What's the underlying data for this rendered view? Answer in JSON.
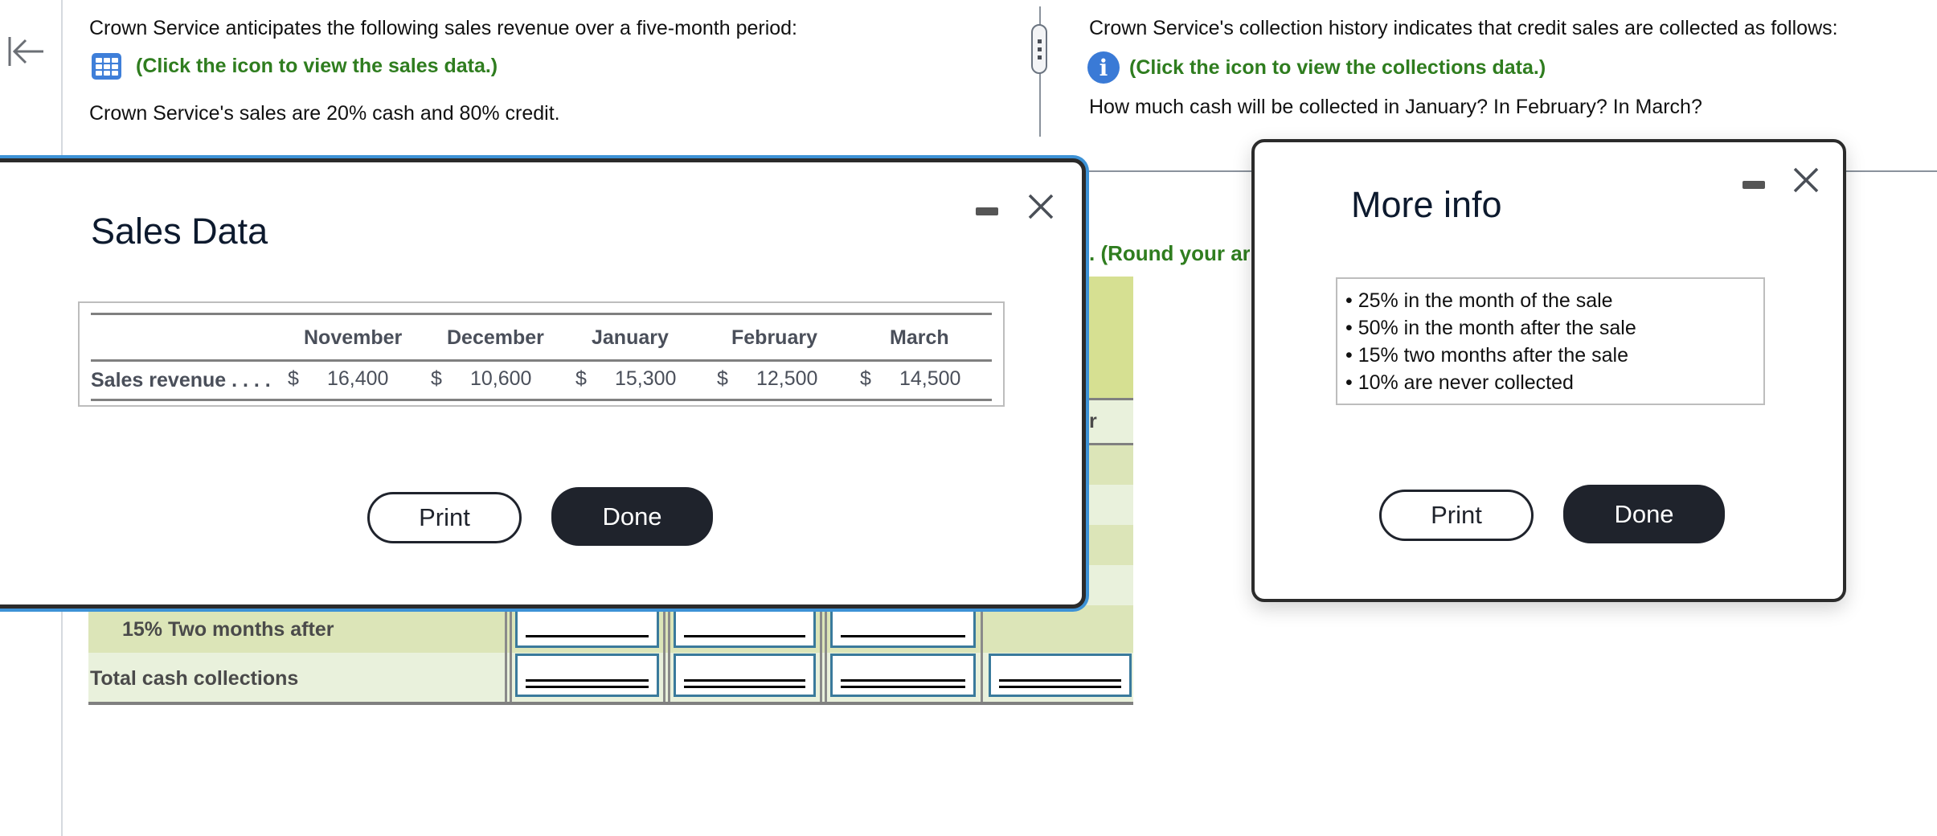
{
  "nav": {
    "back_icon": "collapse-left-arrow"
  },
  "left_pane": {
    "intro": "Crown Service anticipates the following sales revenue over a five-month period:",
    "sales_link": "(Click the icon to view the sales data.)",
    "sales_icon": "table-grid-icon",
    "cash_credit": "Crown Service's sales are 20% cash and 80% credit."
  },
  "right_pane": {
    "intro": "Crown Service's collection history indicates that credit sales are collected as follows:",
    "collections_link": "(Click the icon to view the collections data.)",
    "collections_icon": "info-icon",
    "question": "How much cash will be collected in January? In February? In March?",
    "round_note": ". (Round your ar"
  },
  "answer_table": {
    "header_partial": "r",
    "rows": [
      {
        "label": "15% Two months after"
      },
      {
        "label": "Total cash collections"
      }
    ]
  },
  "sales_dialog": {
    "title": "Sales Data",
    "columns": [
      "November",
      "December",
      "January",
      "February",
      "March"
    ],
    "row_label": "Sales revenue . . . .",
    "currency": "$",
    "values": [
      "16,400",
      "10,600",
      "15,300",
      "12,500",
      "14,500"
    ],
    "print_label": "Print",
    "done_label": "Done"
  },
  "info_dialog": {
    "title": "More info",
    "items": [
      "25% in the month of the sale",
      "50% in the month after the sale",
      "15% two months after the sale",
      "10% are never collected"
    ],
    "print_label": "Print",
    "done_label": "Done"
  },
  "colors": {
    "link_green": "#2f7d1f",
    "dialog_accent_blue": "#3d92d6",
    "button_dark": "#1f232c",
    "table_header_green": "#d6e092",
    "table_band_dark": "#dce5b8",
    "table_band_light": "#e9f1dc",
    "input_border": "#3a7a9c"
  }
}
